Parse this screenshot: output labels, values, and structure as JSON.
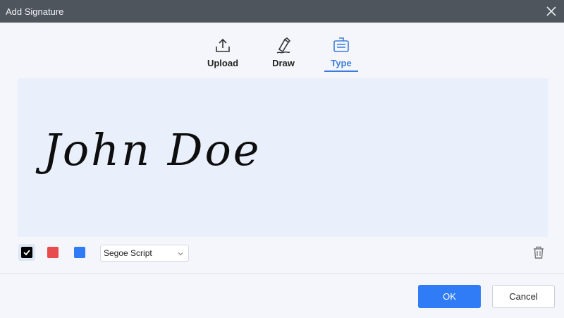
{
  "window": {
    "title": "Add Signature",
    "close_icon": "close-icon"
  },
  "tabs": [
    {
      "label": "Upload",
      "icon": "upload-icon",
      "active": false
    },
    {
      "label": "Draw",
      "icon": "pen-icon",
      "active": false
    },
    {
      "label": "Type",
      "icon": "keyboard-icon",
      "active": true
    }
  ],
  "signature": {
    "text": "John Doe"
  },
  "colors": {
    "options": [
      "#000000",
      "#e84c4c",
      "#2f7cf6"
    ],
    "selected": "#000000",
    "accent": "#3b7ddd"
  },
  "font_select": {
    "value": "Segoe Script"
  },
  "buttons": {
    "ok": "OK",
    "cancel": "Cancel"
  }
}
